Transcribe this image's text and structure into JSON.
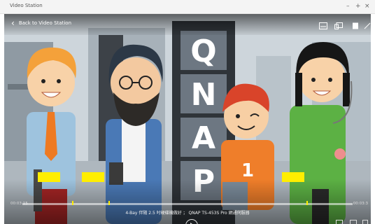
{
  "window": {
    "title": "Video Station"
  },
  "topbar": {
    "back_label": "Back to Video Station"
  },
  "player": {
    "caption": "4-Bay 伴隨 2.5 吋硬碟機做好 ； QNAP TS-453S Pro 網通伺服器",
    "time_current": "00:03:15",
    "time_total": "00:03:3",
    "marker_positions": [
      0.15,
      0.26,
      0.86
    ],
    "annotation_color": "#ffee00"
  },
  "scene": {
    "sign_letters": [
      "Q",
      "N",
      "A",
      "P"
    ],
    "shirt_number": "1"
  }
}
